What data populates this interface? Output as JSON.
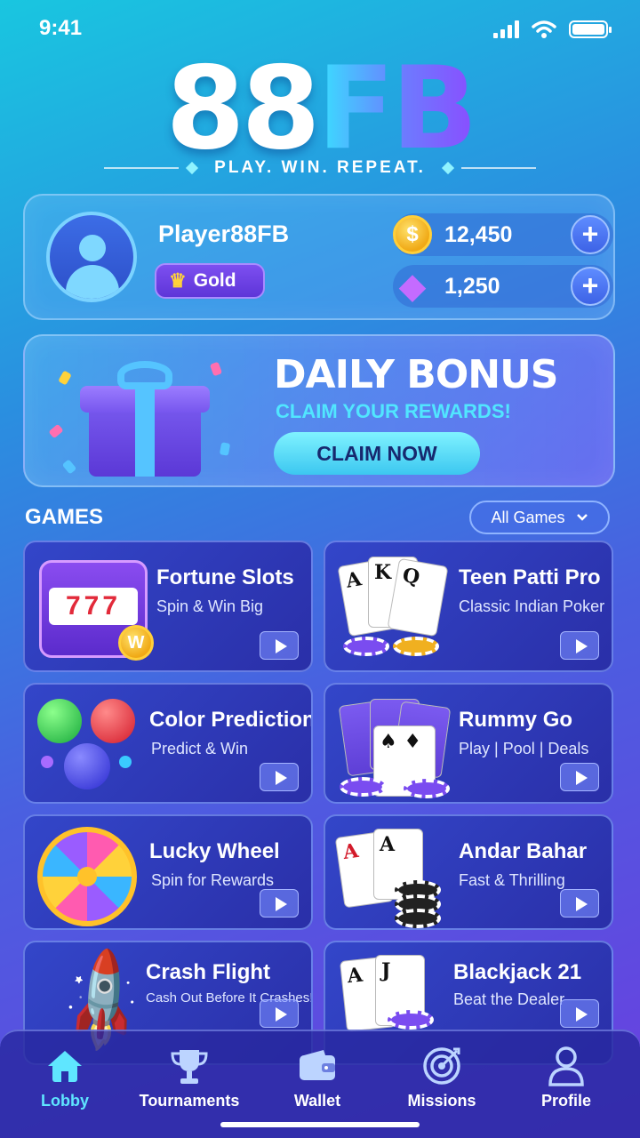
{
  "status_bar": {
    "time": "9:41"
  },
  "brand": {
    "logo_part1": "88",
    "logo_part2": "FB",
    "tagline": "PLAY. WIN. REPEAT."
  },
  "profile": {
    "username": "Player88FB",
    "rank": "Gold",
    "coins": "12,450",
    "gems": "1,250",
    "coin_icon_glyph": "$"
  },
  "bonus": {
    "title": "DAILY BONUS",
    "subtitle": "CLAIM YOUR REWARDS!",
    "cta": "CLAIM NOW"
  },
  "games": {
    "title": "GAMES",
    "filter": "All Games",
    "items": [
      {
        "name": "Fortune Slots",
        "subtitle": "Spin & Win Big",
        "reels": "777",
        "badge": "W"
      },
      {
        "name": "Teen Patti Pro",
        "subtitle": "Classic Indian Poker",
        "cards": [
          "A",
          "K",
          "Q"
        ]
      },
      {
        "name": "Color Prediction",
        "subtitle": "Predict & Win"
      },
      {
        "name": "Rummy Go",
        "subtitle": "Play | Pool | Deals"
      },
      {
        "name": "Lucky Wheel",
        "subtitle": "Spin for Rewards"
      },
      {
        "name": "Andar Bahar",
        "subtitle": "Fast & Thrilling",
        "cards": [
          "A",
          "A"
        ]
      },
      {
        "name": "Crash Flight",
        "subtitle": "Cash Out Before It Crashes!"
      },
      {
        "name": "Blackjack 21",
        "subtitle": "Beat the Dealer",
        "cards": [
          "A",
          "J"
        ]
      }
    ]
  },
  "nav": {
    "items": [
      {
        "label": "Lobby",
        "icon": "home-icon",
        "active": true
      },
      {
        "label": "Tournaments",
        "icon": "trophy-icon",
        "active": false
      },
      {
        "label": "Wallet",
        "icon": "wallet-icon",
        "active": false
      },
      {
        "label": "Missions",
        "icon": "target-icon",
        "active": false
      },
      {
        "label": "Profile",
        "icon": "user-icon",
        "active": false
      }
    ]
  },
  "colors": {
    "accent": "#5fe6ff",
    "gold": "#ffc22a",
    "purple": "#6a3fe0"
  }
}
